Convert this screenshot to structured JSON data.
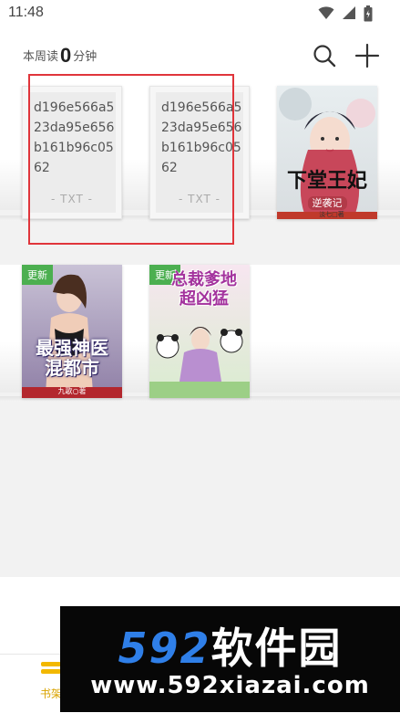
{
  "status_bar": {
    "time": "11:48",
    "icons": [
      "wifi-icon",
      "signal-icon",
      "battery-icon"
    ]
  },
  "header": {
    "weekly_prefix": "本周读",
    "weekly_value": "0",
    "weekly_suffix": "分钟",
    "icons": [
      "search-icon",
      "plus-icon"
    ]
  },
  "books": [
    {
      "type": "txt",
      "name": "d196e566a523da95e656b161b96c0562",
      "ext": "- TXT -"
    },
    {
      "type": "txt",
      "name": "d196e566a523da95e656b161b96c0562",
      "ext": "- TXT -"
    },
    {
      "type": "cover",
      "title": "下堂王妃",
      "subtitle": "逆袭记",
      "author": "淡七□著"
    },
    {
      "type": "cover",
      "badge": "更新",
      "title": "最强神医混都市",
      "author": "九歌○著"
    },
    {
      "type": "cover",
      "badge": "更新",
      "title": "总裁爹地超凶猛"
    }
  ],
  "bottom_nav": {
    "bookshelf_label": "书架"
  },
  "watermark": {
    "digits": "592",
    "brand": "软件园",
    "url": "www.592xiazai.com"
  },
  "colors": {
    "accent": "#d9a300",
    "highlight_border": "#e0353b",
    "badge": "#4caf50",
    "watermark_blue": "#2f7fe8"
  }
}
